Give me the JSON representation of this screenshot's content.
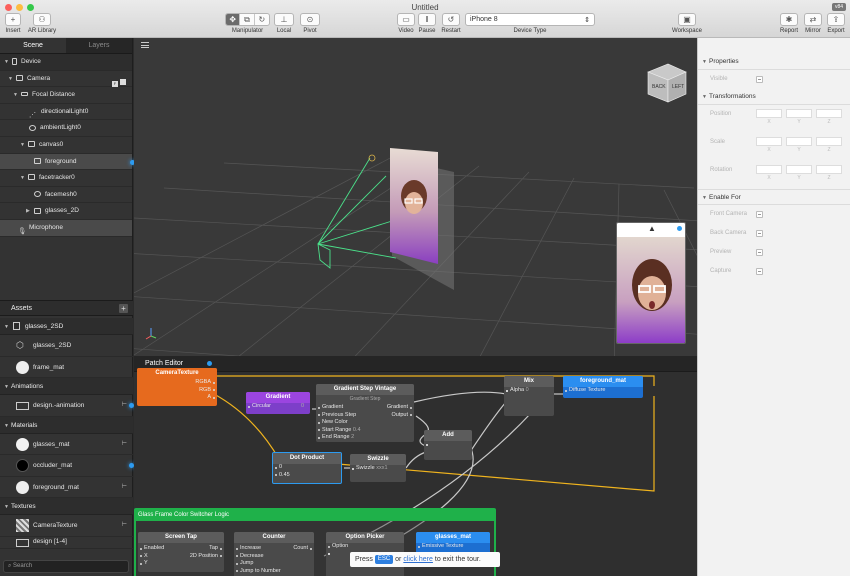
{
  "window": {
    "title": "Untitled",
    "version_badge": "v84"
  },
  "toolbar": {
    "insert_label": "Insert",
    "ar_library_label": "AR Library",
    "manipulator_label": "Manipulator",
    "local_label": "Local",
    "pivot_label": "Pivot",
    "video_label": "Video",
    "pause_label": "Pause",
    "restart_label": "Restart",
    "device_type_label": "Device Type",
    "device_type_value": "iPhone 8",
    "workspace_label": "Workspace",
    "report_label": "Report",
    "mirror_label": "Mirror",
    "export_label": "Export"
  },
  "left_panel": {
    "tabs": [
      "Scene",
      "Layers"
    ],
    "scene_items": [
      {
        "label": "Device"
      },
      {
        "label": "Camera"
      },
      {
        "label": "Focal Distance"
      },
      {
        "label": "directionalLight0"
      },
      {
        "label": "ambientLight0"
      },
      {
        "label": "canvas0"
      },
      {
        "label": "foreground"
      },
      {
        "label": "facetracker0"
      },
      {
        "label": "facemesh0"
      },
      {
        "label": "glasses_2D"
      },
      {
        "label": "Microphone"
      }
    ],
    "assets_title": "Assets",
    "assets": {
      "group_glasses": "glasses_2SD",
      "glasses_item": "glasses_2SD",
      "frame_mat": "frame_mat",
      "animations_label": "Animations",
      "design_animation": "design.-animation",
      "materials_label": "Materials",
      "glasses_mat": "glasses_mat",
      "occluder_mat": "occluder_mat",
      "foreground_mat": "foreground_mat",
      "textures_label": "Textures",
      "camera_texture": "CameraTexture",
      "design_partial": "design [1-4]"
    },
    "search_placeholder": "Search"
  },
  "inspector": {
    "properties_label": "Properties",
    "visible_label": "Visible",
    "transformations_label": "Transformations",
    "position_label": "Position",
    "scale_label": "Scale",
    "rotation_label": "Rotation",
    "axis_labels": [
      "X",
      "Y",
      "Z"
    ],
    "enable_for_label": "Enable For",
    "front_camera_label": "Front Camera",
    "back_camera_label": "Back Camera",
    "preview_label": "Preview",
    "capture_label": "Capture"
  },
  "viewport": {
    "cube_back": "BACK",
    "cube_left": "LEFT"
  },
  "patch_editor": {
    "title": "Patch Editor",
    "camera_texture": {
      "title": "CameraTexture",
      "ports": [
        "RGBA",
        "RGB",
        "A"
      ]
    },
    "gradient": {
      "title": "Gradient",
      "port": "Circular",
      "value": "0"
    },
    "gradient_step": {
      "title": "Gradient Step Vintage",
      "subtitle": "Gradient Step",
      "in_ports": [
        "Gradient",
        "Previous Step",
        "New Color",
        "Start Range",
        "End Range"
      ],
      "start_value": "0.4",
      "end_value": "2",
      "out_ports": [
        "Gradient",
        "Output"
      ]
    },
    "dot_product": {
      "title": "Dot Product",
      "value1": "0",
      "value2": "0.45"
    },
    "swizzle": {
      "title": "Swizzle",
      "port": "Swizzle",
      "value": "xxx1"
    },
    "add": {
      "title": "Add"
    },
    "mix": {
      "title": "Mix",
      "port": "Alpha",
      "value": "0"
    },
    "foreground_mat": {
      "title": "foreground_mat",
      "port": "Diffuse Texture"
    },
    "group_title": "Glass Frame Color Switcher Logic",
    "screen_tap": {
      "title": "Screen Tap",
      "ports": [
        "Enabled",
        "X",
        "Y"
      ],
      "out_ports": [
        "Tap",
        "2D Position"
      ]
    },
    "counter": {
      "title": "Counter",
      "ports": [
        "Increase",
        "Decrease",
        "Jump",
        "Jump to Number"
      ],
      "out_ports": [
        "Count"
      ]
    },
    "option_picker": {
      "title": "Option Picker",
      "port": "Option"
    },
    "glasses_mat": {
      "title": "glasses_mat",
      "port": "Emissive Texture"
    },
    "tour": {
      "press": "Press",
      "esc": "ESC",
      "or": "or",
      "click_here": "click here",
      "tail": "to exit the tour."
    }
  }
}
